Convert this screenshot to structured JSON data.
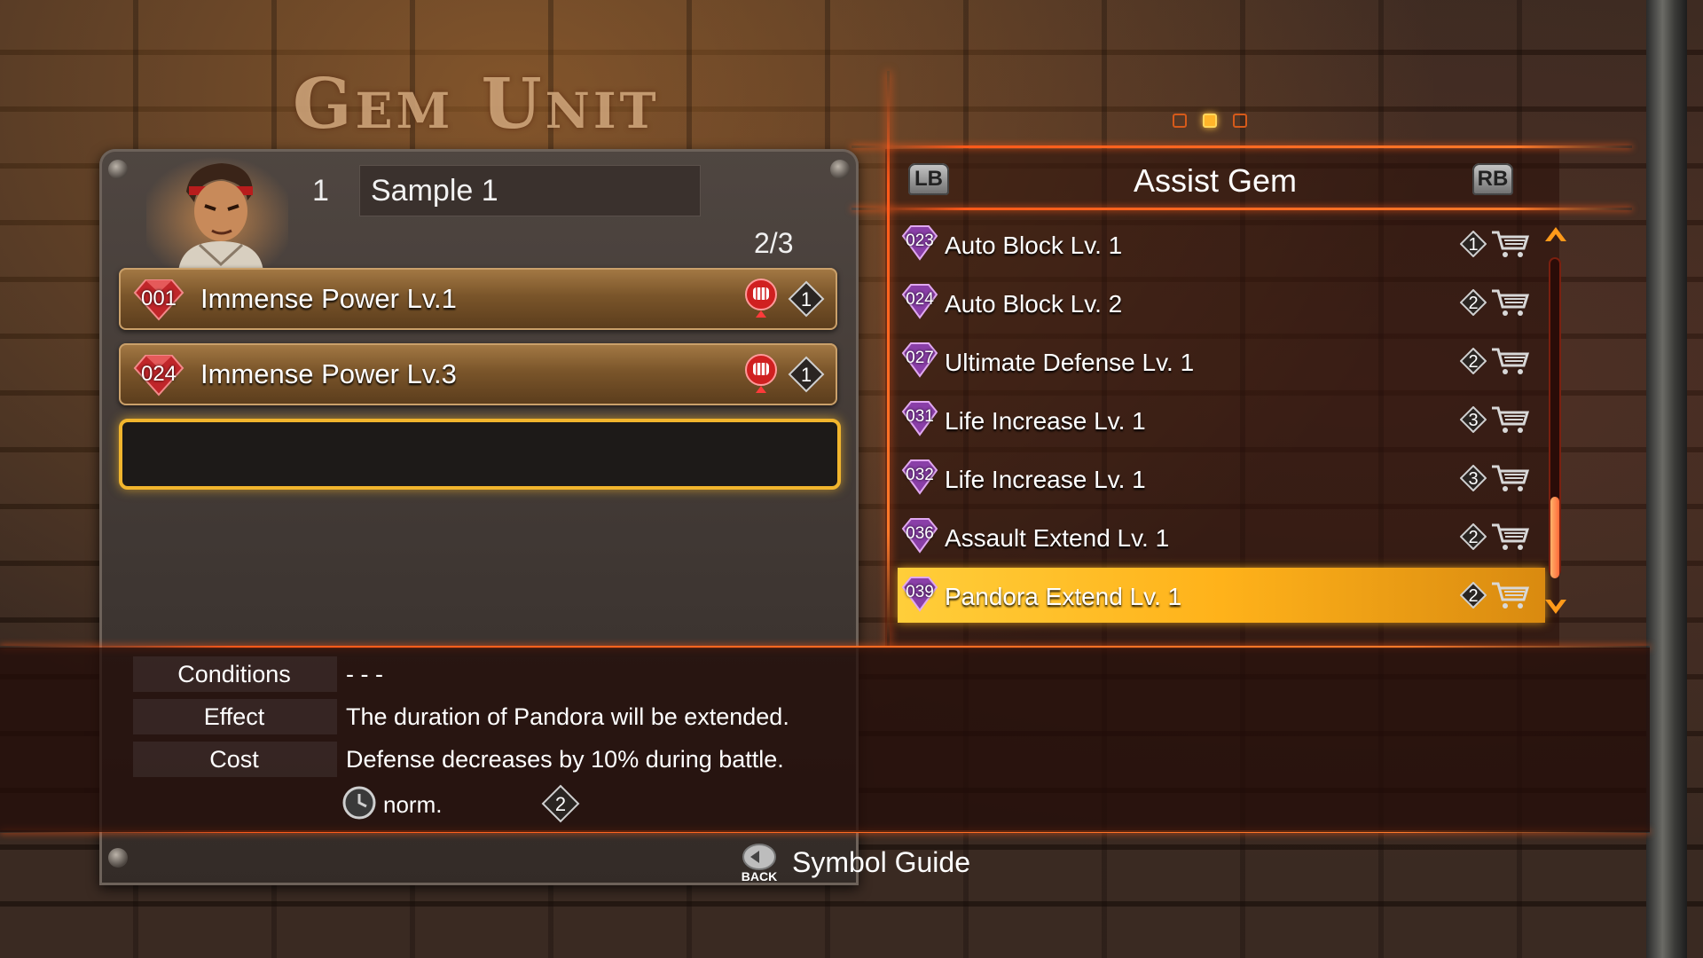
{
  "screen_title": "Gem Unit",
  "loadout": {
    "number": "1",
    "name": "Sample 1",
    "slots_used": "2/3",
    "equipped": [
      {
        "id": "001",
        "name": "Immense Power Lv.1",
        "cost": "1"
      },
      {
        "id": "024",
        "name": "Immense Power Lv.3",
        "cost": "1"
      }
    ]
  },
  "gem_list": {
    "category": "Assist Gem",
    "lb_label": "LB",
    "rb_label": "RB",
    "page_current": 2,
    "page_total": 3,
    "items": [
      {
        "id": "023",
        "name": "Auto Block Lv. 1",
        "cost": "1"
      },
      {
        "id": "024",
        "name": "Auto Block Lv. 2",
        "cost": "2"
      },
      {
        "id": "027",
        "name": "Ultimate Defense Lv. 1",
        "cost": "2"
      },
      {
        "id": "031",
        "name": "Life Increase Lv. 1",
        "cost": "3"
      },
      {
        "id": "032",
        "name": "Life Increase Lv. 1",
        "cost": "3"
      },
      {
        "id": "036",
        "name": "Assault Extend Lv. 1",
        "cost": "2"
      },
      {
        "id": "039",
        "name": "Pandora Extend Lv. 1",
        "cost": "2"
      }
    ],
    "selected_index": 6
  },
  "details": {
    "conditions_label": "Conditions",
    "conditions_value": "- - -",
    "effect_label": "Effect",
    "effect_value": "The duration of Pandora will be extended.",
    "cost_label": "Cost",
    "cost_value": "Defense decreases by 10% during battle.",
    "timing": "norm.",
    "gem_cost": "2"
  },
  "footer": {
    "back_label": "BACK",
    "symbol_guide": "Symbol Guide"
  },
  "colors": {
    "accent_orange": "#ff5a1a",
    "selected_gold": "#ffb21a",
    "empty_slot_border": "#f1b52d",
    "power_gem_red": "#c0262a",
    "assist_gem_purple": "#8a3fa8"
  }
}
